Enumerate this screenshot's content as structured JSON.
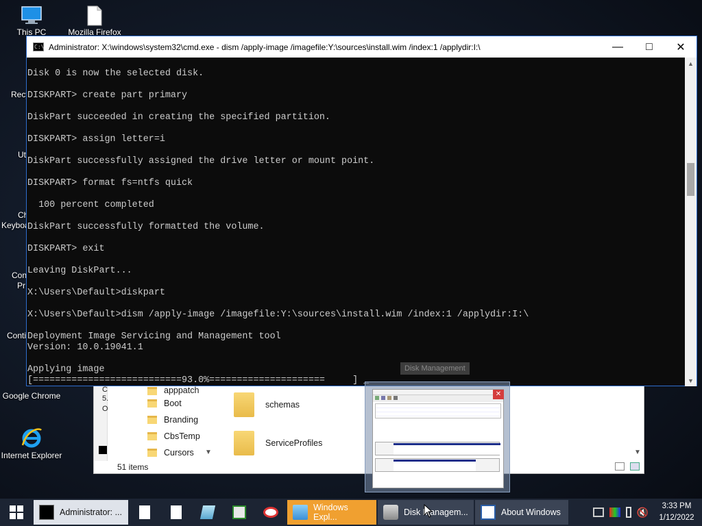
{
  "desktop": {
    "icons": [
      {
        "label": "This PC",
        "icon": "computer-icon"
      },
      {
        "label": "Mozilla Firefox",
        "icon": "file-icon"
      },
      {
        "label": "Google Chrome",
        "icon": "chrome-icon"
      },
      {
        "label": "Internet Explorer",
        "icon": "ie-icon"
      }
    ],
    "partial_labels": [
      "Recy",
      "Ut",
      "Ch",
      "Keyboa",
      "Con",
      "Pr",
      "Conti"
    ]
  },
  "console": {
    "title": "Administrator: X:\\windows\\system32\\cmd.exe - dism  /apply-image /imagefile:Y:\\sources\\install.wim /index:1 /applydir:I:\\",
    "lines": [
      "Disk 0 is now the selected disk.",
      "",
      "DISKPART> create part primary",
      "",
      "DiskPart succeeded in creating the specified partition.",
      "",
      "DISKPART> assign letter=i",
      "",
      "DiskPart successfully assigned the drive letter or mount point.",
      "",
      "DISKPART> format fs=ntfs quick",
      "",
      "  100 percent completed",
      "",
      "DiskPart successfully formatted the volume.",
      "",
      "DISKPART> exit",
      "",
      "Leaving DiskPart...",
      "",
      "X:\\Users\\Default>diskpart",
      "",
      "X:\\Users\\Default>dism /apply-image /imagefile:Y:\\sources\\install.wim /index:1 /applydir:I:\\",
      "",
      "Deployment Image Servicing and Management tool",
      "Version: 10.0.19041.1",
      "",
      "Applying image",
      "[===========================93.0%=====================     ] _"
    ],
    "progress_percent": 93.0
  },
  "explorer": {
    "nav_items": [
      "apppatch",
      "Boot",
      "Branding",
      "CbsTemp",
      "Cursors"
    ],
    "files": [
      "schemas",
      "ServiceProfiles"
    ],
    "status": "51 items",
    "left_fragments": [
      "C",
      "5.",
      "O"
    ]
  },
  "preview": {
    "tooltip": "Disk Management"
  },
  "taskbar": {
    "buttons": [
      {
        "label": "Administrator: ...",
        "icon": "cmd-icon"
      },
      {
        "label": "Windows Expl...",
        "icon": "explorer-icon"
      },
      {
        "label": "Disk Managem...",
        "icon": "disk-management-icon"
      },
      {
        "label": "About Windows",
        "icon": "about-windows-icon"
      }
    ],
    "time": "3:33 PM",
    "date": "1/12/2022"
  }
}
